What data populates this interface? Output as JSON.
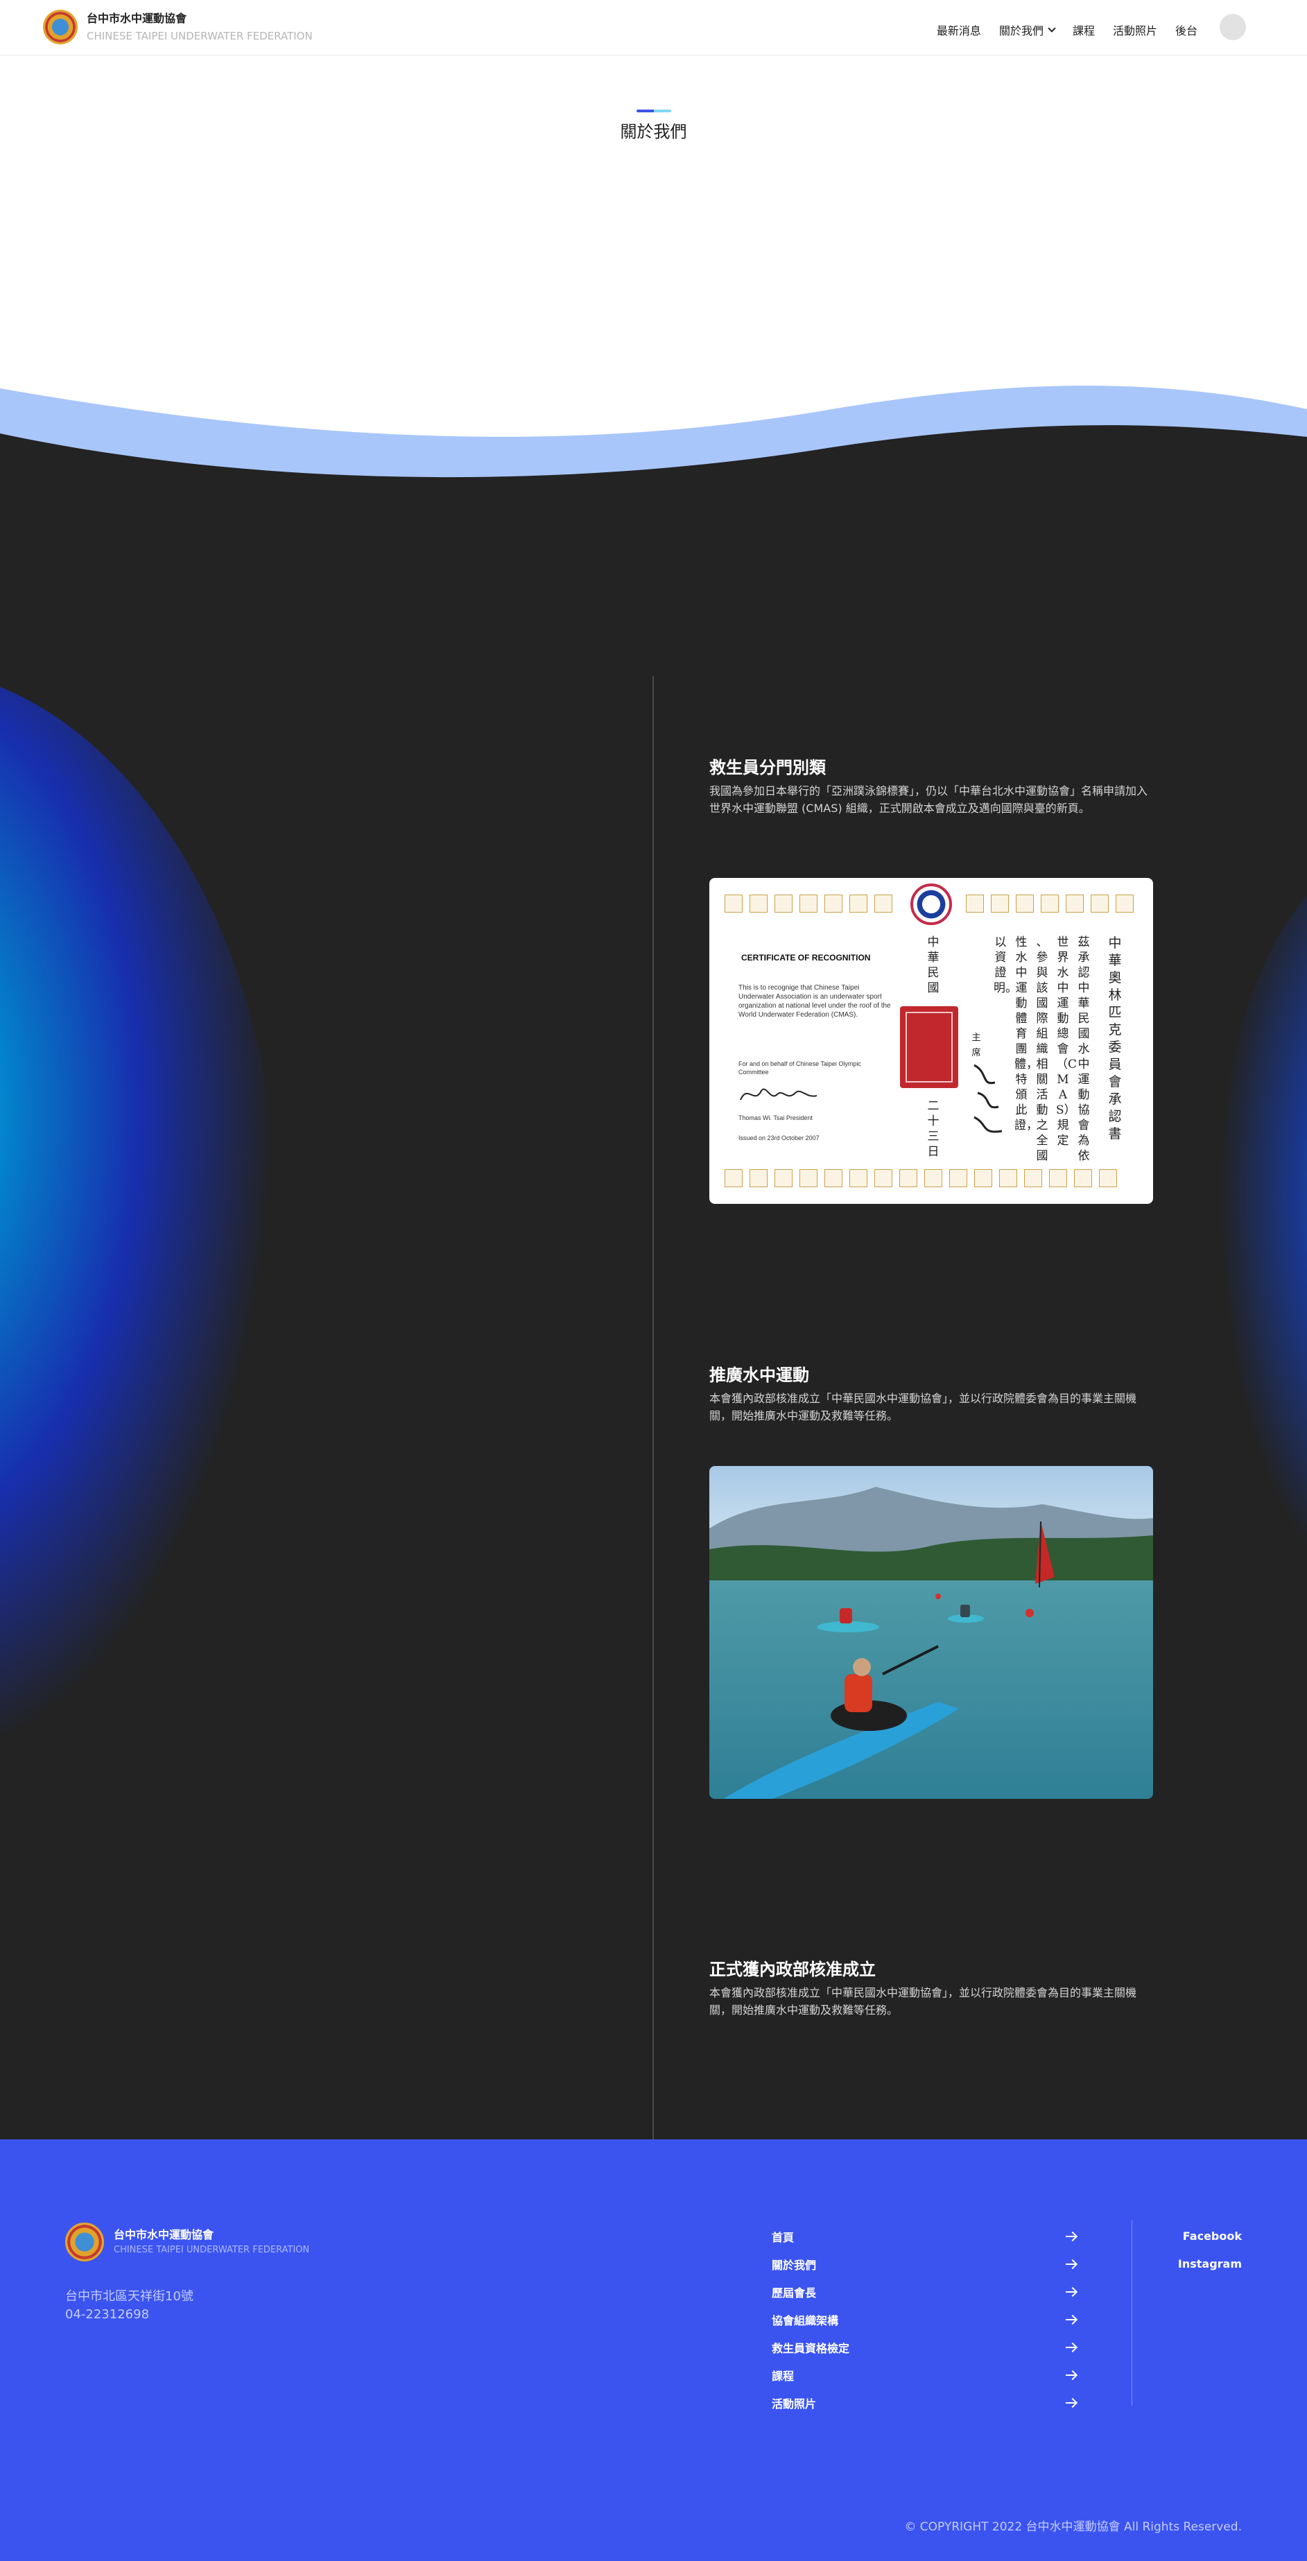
{
  "header": {
    "brand_name": "台中市水中運動協會",
    "brand_sub": "CHINESE TAIPEI UNDERWATER FEDERATION",
    "nav": [
      "最新消息",
      "關於我們",
      "課程",
      "活動照片",
      "後台"
    ]
  },
  "page_title": "關於我們",
  "timeline": [
    {
      "title": "救生員分門別類",
      "desc": "我國為參加日本舉行的「亞洲蹼泳錦標賽」，仍以「中華台北水中運動協會」名稱申請加入世界水中運動聯盟 (CMAS) 組織，正式開啟本會成立及邁向國際與臺的新頁。"
    },
    {
      "title": "推廣水中運動",
      "desc": "本會獲內政部核准成立「中華民國水中運動協會」，並以行政院體委會為目的事業主關機關，開始推廣水中運動及救難等任務。"
    },
    {
      "title": "正式獲內政部核准成立",
      "desc": "本會獲內政部核准成立「中華民國水中運動協會」，並以行政院體委會為目的事業主關機關，開始推廣水中運動及救難等任務。"
    }
  ],
  "certificate": {
    "heading": "CERTIFICATE OF RECOGNITION",
    "body": "This is to recognige that Chinese Taipei Underwater Association is an underwater sport organization at national level under the roof of the World Underwater Federation (CMAS).",
    "sign_label": "For and on behalf of Chinese Taipei Olympic Committee",
    "signer": "Thomas Wi. Tsai President",
    "issued": "Issued on 23rd October 2007",
    "col_title": "中華奧林匹克委員會承認書",
    "col_1": "茲承認中華民國水中運動協會為依",
    "col_2": "世界水中運動總會（CMAS）規定",
    "col_3": "、參與該國際組織相關活動之全國",
    "col_4": "性水中運動體育團體，特頒此證，",
    "col_5": "以資證明。",
    "col_president": "主席",
    "col_date_1": "中華民國",
    "col_date_2": "二十三日"
  },
  "footer": {
    "brand_name": "台中市水中運動協會",
    "brand_sub": "CHINESE TAIPEI UNDERWATER FEDERATION",
    "address": "台中市北區天祥街10號",
    "phone": "04-22312698",
    "links": [
      "首頁",
      "關於我們",
      "歷屆會長",
      "協會組織架構",
      "救生員資格檢定",
      "課程",
      "活動照片"
    ],
    "social": [
      "Facebook",
      "Instagram"
    ],
    "copyright": "© COPYRIGHT 2022 台中水中運動協會 All Rights Reserved."
  },
  "colors": {
    "footer_bg": "#3b54f0",
    "dark_bg": "#232323",
    "wave": "#a9c6fb",
    "accent_blue": "#3b54e8",
    "accent_cyan": "#7fd8f5"
  }
}
